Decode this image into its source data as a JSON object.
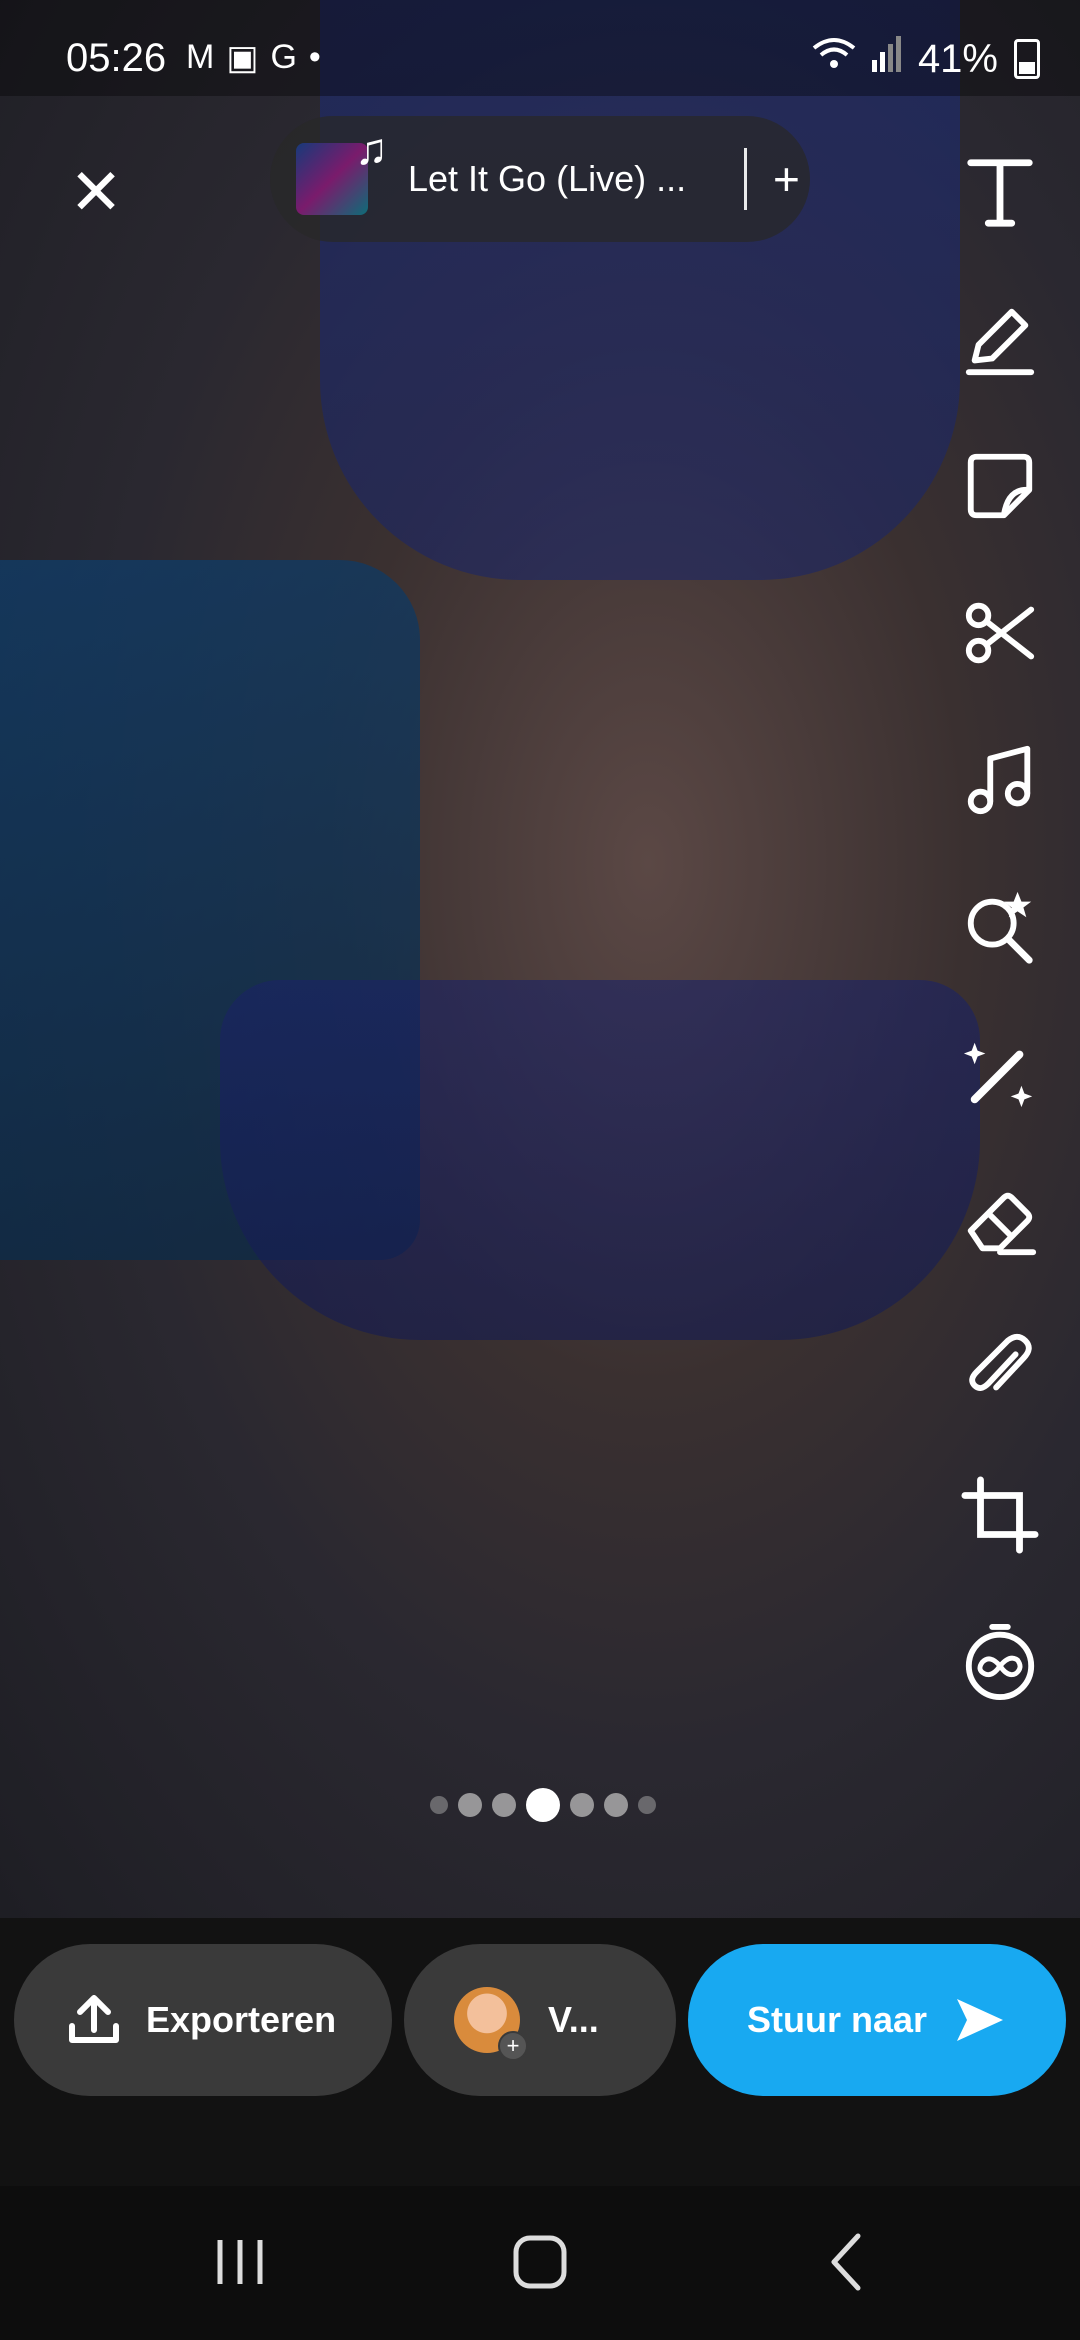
{
  "status_bar": {
    "time": "05:26",
    "notification_icons": [
      "gmail-icon",
      "gallery-icon",
      "google-icon",
      "dot-icon"
    ],
    "battery": "41%"
  },
  "music": {
    "title": "Let It Go (Live) ...",
    "add_symbol": "+"
  },
  "tools": [
    {
      "name": "text-tool",
      "icon": "text-icon"
    },
    {
      "name": "draw-tool",
      "icon": "pencil-icon"
    },
    {
      "name": "sticker-tool",
      "icon": "sticker-icon"
    },
    {
      "name": "scissors-tool",
      "icon": "scissors-icon"
    },
    {
      "name": "music-tool",
      "icon": "music-note-icon"
    },
    {
      "name": "lens-search-tool",
      "icon": "search-star-icon"
    },
    {
      "name": "magic-tool",
      "icon": "magic-wand-icon"
    },
    {
      "name": "eraser-tool",
      "icon": "eraser-icon"
    },
    {
      "name": "attach-tool",
      "icon": "paperclip-icon"
    },
    {
      "name": "crop-tool",
      "icon": "crop-icon"
    },
    {
      "name": "timer-tool",
      "icon": "infinity-timer-icon"
    }
  ],
  "page_indicator": {
    "count": 7,
    "active_index": 3
  },
  "actions": {
    "export_label": "Exporteren",
    "story_label": "V...",
    "send_label": "Stuur naar"
  },
  "colors": {
    "send_button": "#18a9f1",
    "pill_background": "#3a3a3a"
  }
}
